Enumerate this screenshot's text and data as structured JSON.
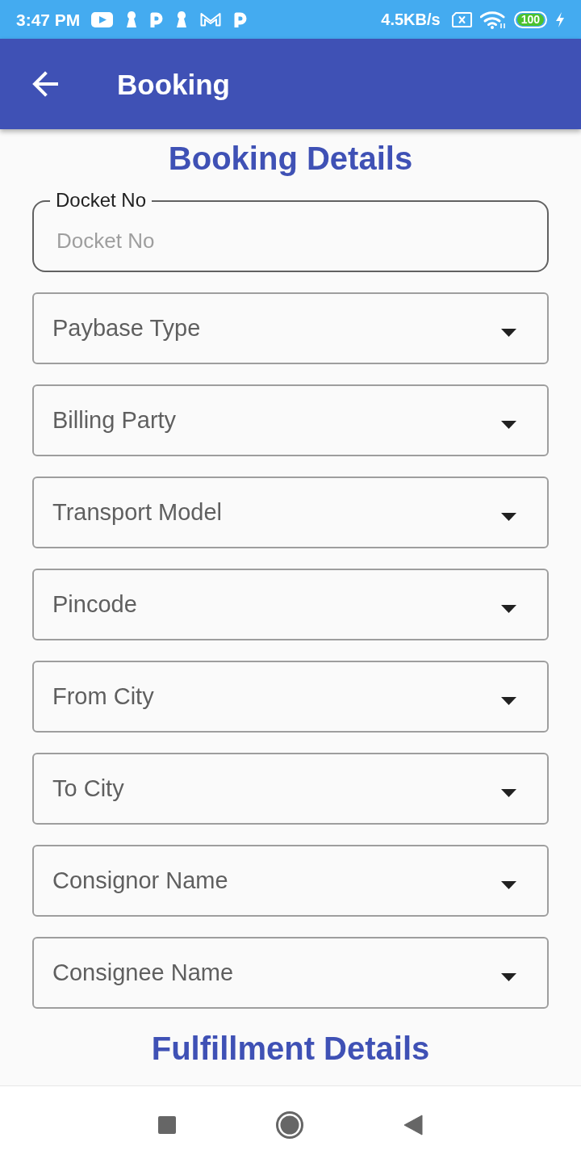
{
  "status_bar": {
    "time": "3:47 PM",
    "net_speed": "4.5KB/s",
    "battery": "100"
  },
  "app_bar": {
    "title": "Booking"
  },
  "booking_details": {
    "heading": "Booking Details",
    "docket_no": {
      "label": "Docket No",
      "placeholder": "Docket No"
    },
    "dropdowns": [
      {
        "placeholder": "Paybase Type"
      },
      {
        "placeholder": "Billing Party"
      },
      {
        "placeholder": "Transport Model"
      },
      {
        "placeholder": "Pincode"
      },
      {
        "placeholder": "From City"
      },
      {
        "placeholder": "To City"
      },
      {
        "placeholder": "Consignor Name"
      },
      {
        "placeholder": "Consignee Name"
      }
    ]
  },
  "fulfillment_details": {
    "heading": "Fulfillment Details"
  }
}
